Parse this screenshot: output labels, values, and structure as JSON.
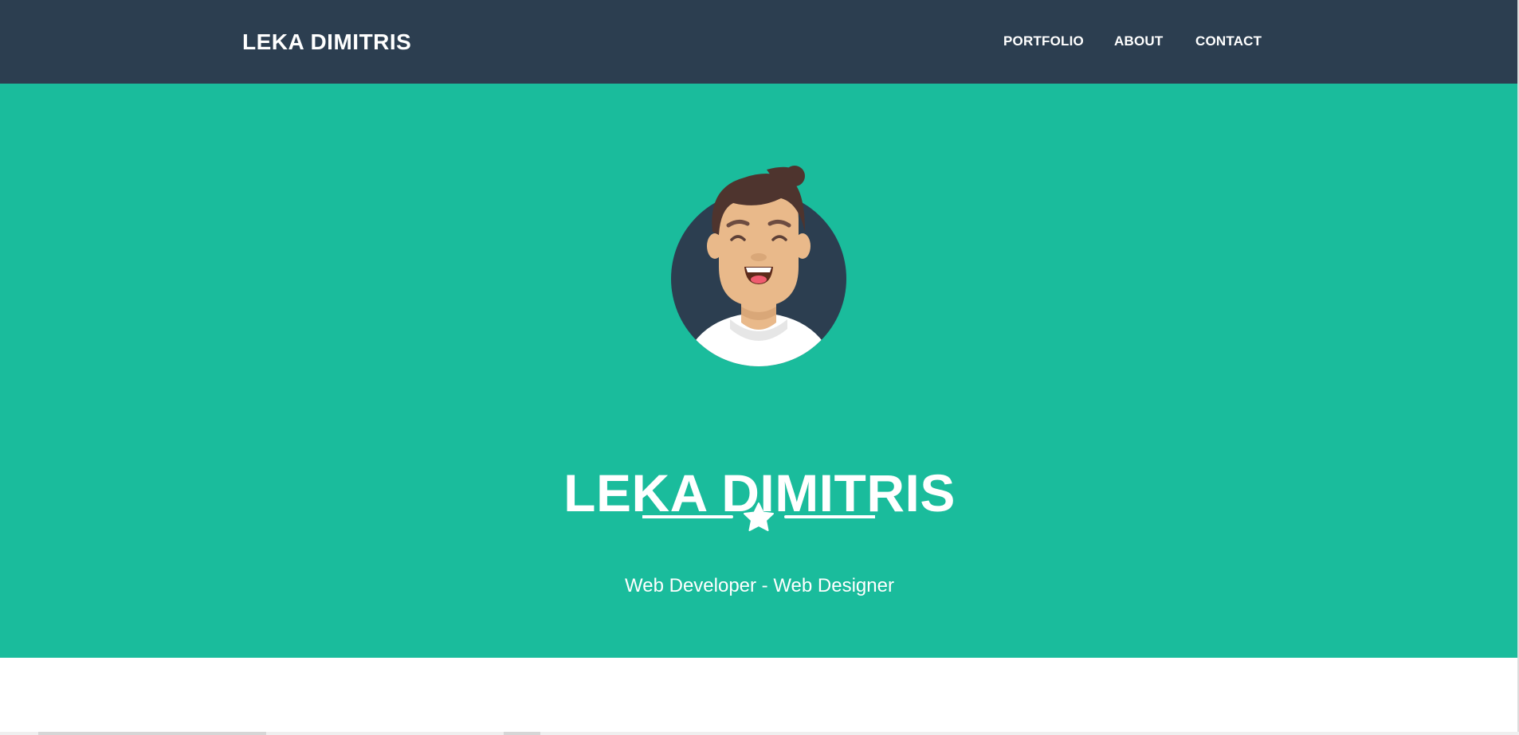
{
  "colors": {
    "navbar_bg": "#2c3e50",
    "hero_bg": "#1abc9c",
    "text": "#ffffff"
  },
  "navbar": {
    "brand": "LEKA DIMITRIS",
    "links": [
      {
        "label": "PORTFOLIO"
      },
      {
        "label": "ABOUT"
      },
      {
        "label": "CONTACT"
      }
    ]
  },
  "hero": {
    "avatar_icon": "avatar-illustration",
    "title": "LEKA DIMITRIS",
    "divider_icon": "star-icon",
    "subtitle": "Web Developer - Web Designer"
  }
}
